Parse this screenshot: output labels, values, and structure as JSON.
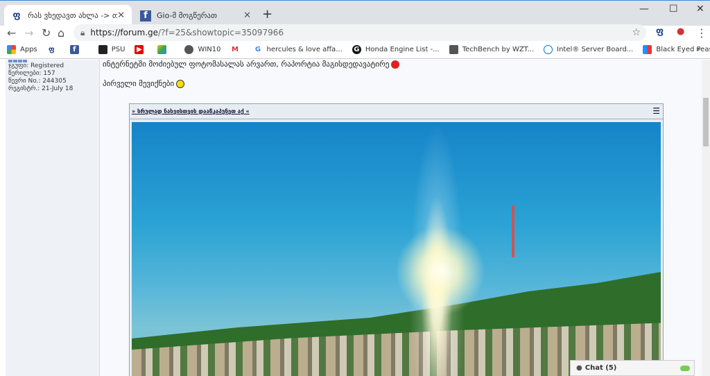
{
  "browser": {
    "tabs": [
      {
        "label": "რას ვხედავთ ახლა -> თბილისი",
        "icon": "forum-ge-icon"
      },
      {
        "label": "Gio-მ მოგწერათ",
        "icon": "facebook-icon"
      }
    ],
    "url_domain": "https://forum.ge",
    "url_path": "/?f=25&showtopic=35097966",
    "bookmarks": [
      "Apps",
      "",
      "",
      "PSU",
      "",
      "",
      "WIN10",
      "",
      "hercules & love affa...",
      "Honda Engine List -...",
      "TechBench by WZT...",
      "Intel® Server Board...",
      "Black Eyed Peas | T..."
    ],
    "more": "»"
  },
  "user": {
    "group": "ჯგუფი: Registered",
    "posts": "წერილები: 157",
    "member_no": "წევრი No.: 244305",
    "registered": "რეგისტრ.: 21-July 18"
  },
  "post": {
    "line1": "ინტერნეტში მოძიებულ ფოტომასალას არვართ, რაპორტია მაგისდედავატირე",
    "line2": "პირველი მევიქნები",
    "image_link": "» სრულად ნახვისთვის დააწკაპუნეთ აქ «"
  },
  "chat": {
    "label": "Chat (5)"
  }
}
